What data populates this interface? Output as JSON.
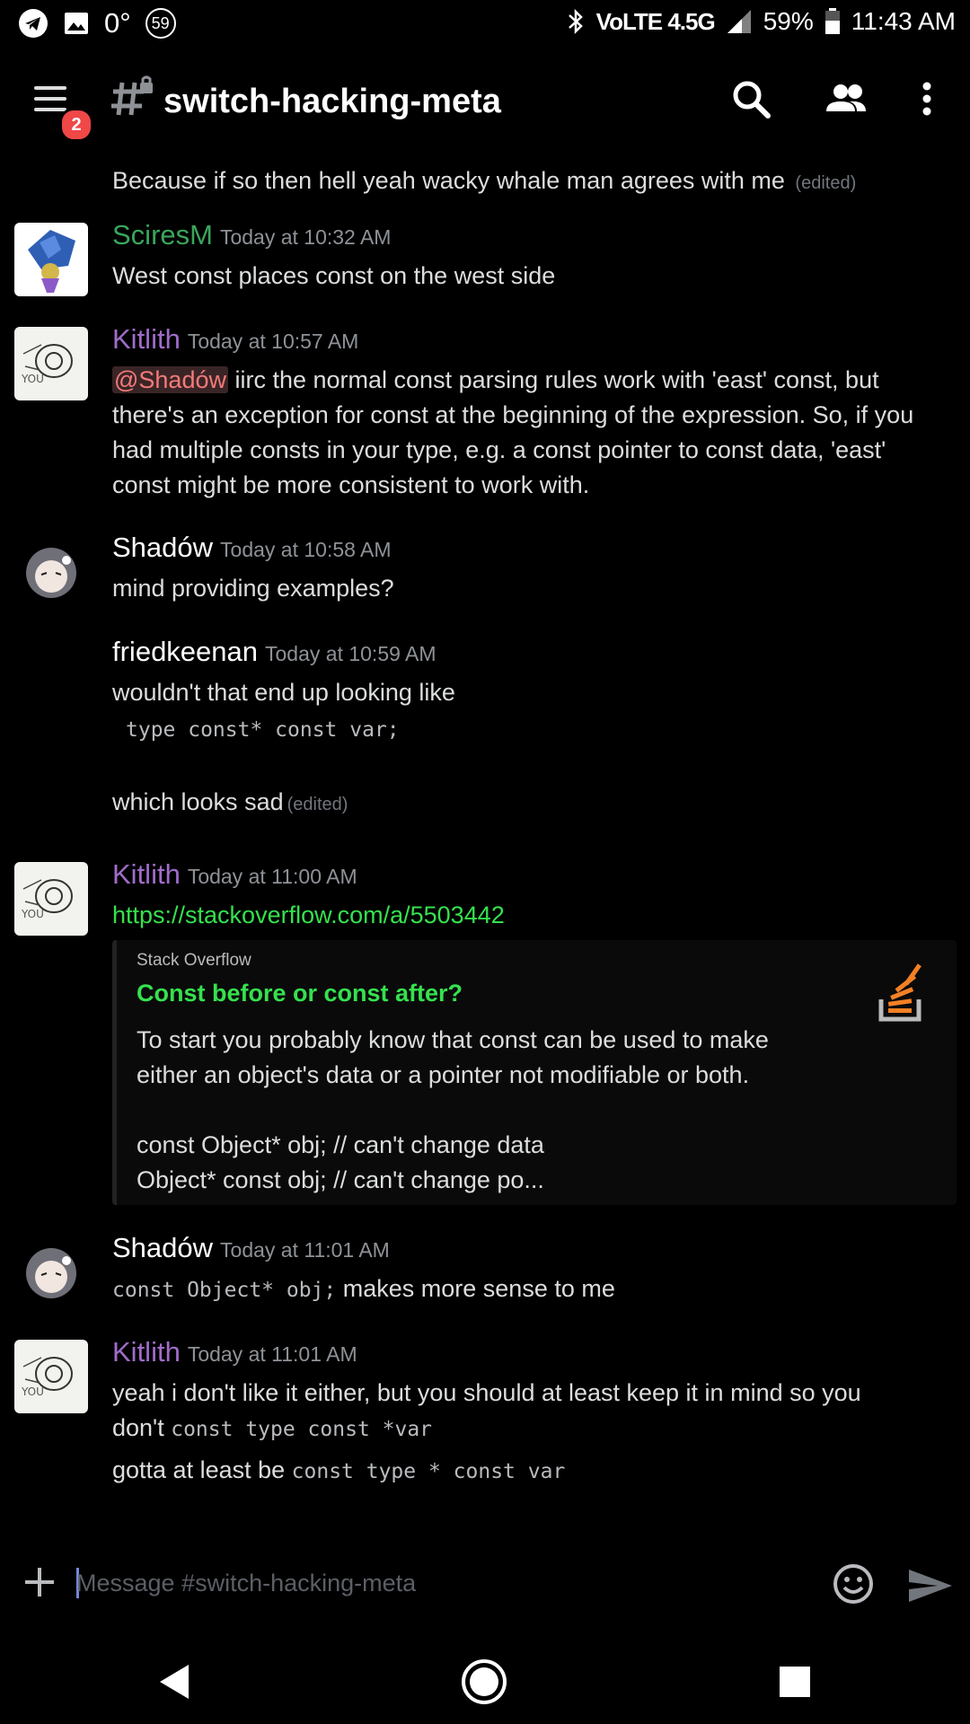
{
  "status_bar": {
    "temperature": "0°",
    "notification_count": "59",
    "network": "VoLTE 4.5G",
    "battery": "59%",
    "time": "11:43 AM"
  },
  "toolbar": {
    "badge_count": "2",
    "channel_name": "switch-hacking-meta"
  },
  "messages": {
    "continuation": {
      "text": "Because if so then hell yeah wacky whale man agrees with me",
      "edited": "(edited)"
    },
    "m1": {
      "author": "SciresM",
      "author_color": "#3ba55c",
      "time": "Today at 10:32 AM",
      "text": "West const places const on the west side"
    },
    "m2": {
      "author": "Kitlith",
      "author_color": "#a06cc9",
      "time": "Today at 10:57 AM",
      "mention": "@Shadów",
      "text": " iirc the normal const parsing rules work with 'east' const, but there's an exception for const at the beginning of the expression. So, if you had multiple consts in your type, e.g. a const pointer to const data, 'east' const might be more consistent to work with."
    },
    "m3": {
      "author": "Shadów",
      "time": "Today at 10:58 AM",
      "text": "mind providing examples?"
    },
    "m4": {
      "author": "friedkeenan",
      "time": "Today at 10:59 AM",
      "text": "wouldn't that end up looking like",
      "code": "type const* const var;",
      "text2": "which looks sad",
      "edited": "(edited)"
    },
    "m5": {
      "author": "Kitlith",
      "time": "Today at 11:00 AM",
      "link": "https://stackoverflow.com/a/5503442",
      "embed": {
        "provider": "Stack Overflow",
        "title": "Const before or const after?",
        "desc_line1": "To start you probably know that const can be used to make",
        "desc_line2": "either an object's data or a pointer not modifiable or both.",
        "desc_line3": "const Object* obj; // can't change data",
        "desc_line4": "Object* const obj; // can't change po..."
      }
    },
    "m6": {
      "author": "Shadów",
      "time": "Today at 11:01 AM",
      "code": "const Object* obj;",
      "text": " makes more sense to me"
    },
    "m7": {
      "author": "Kitlith",
      "time": "Today at 11:01 AM",
      "text_line1": "yeah i don't like it either, but you should at least keep it in mind so you",
      "text_line2": "don't",
      "code1": "const type const *var",
      "text_line3": "gotta at least be",
      "code2": "const type * const var"
    }
  },
  "composer": {
    "placeholder": "Message #switch-hacking-meta"
  }
}
